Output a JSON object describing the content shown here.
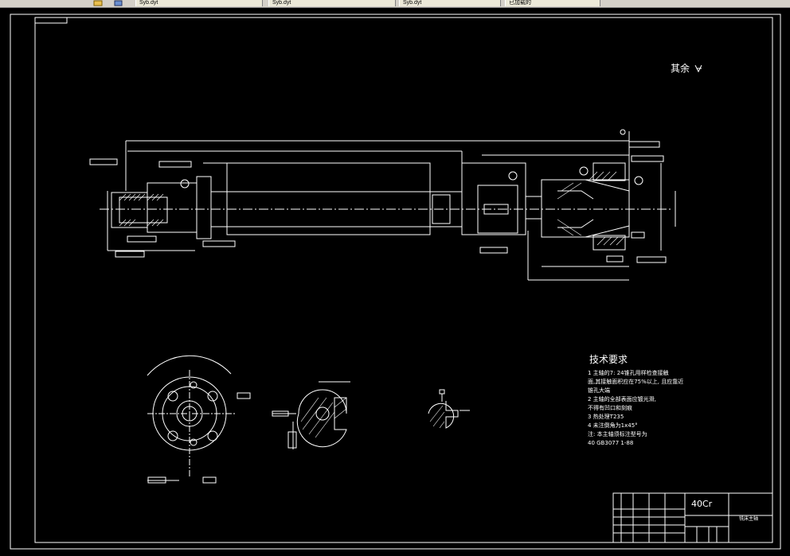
{
  "toolbar": {
    "tabs": [
      {
        "label": "Syb.dyt"
      },
      {
        "label": "Syb.dyt"
      },
      {
        "label": "Syb.dyt"
      },
      {
        "label": "已加载的"
      }
    ]
  },
  "drawing": {
    "roughness_note": "其余",
    "tech_req": {
      "title": "技术要求",
      "lines": [
        "1   主轴的7: 24锥孔用样检查接触",
        "面,其接触面积应在75%以上, 且应靠近",
        "锥孔大端",
        "2   主轴的全部表面应镀光滑,",
        "不得有凹口和刻痕",
        "3   热处理T235",
        "4   未注倒角为1x45°",
        "注: 本主轴须标注型号为",
        "      40 GB3077 1-88"
      ]
    },
    "title_block": {
      "material": "40Cr",
      "part_name": "铣床主轴"
    }
  },
  "colors": {
    "background": "#000000",
    "lines": "#ffffff",
    "toolbar": "#d4d0c8"
  }
}
